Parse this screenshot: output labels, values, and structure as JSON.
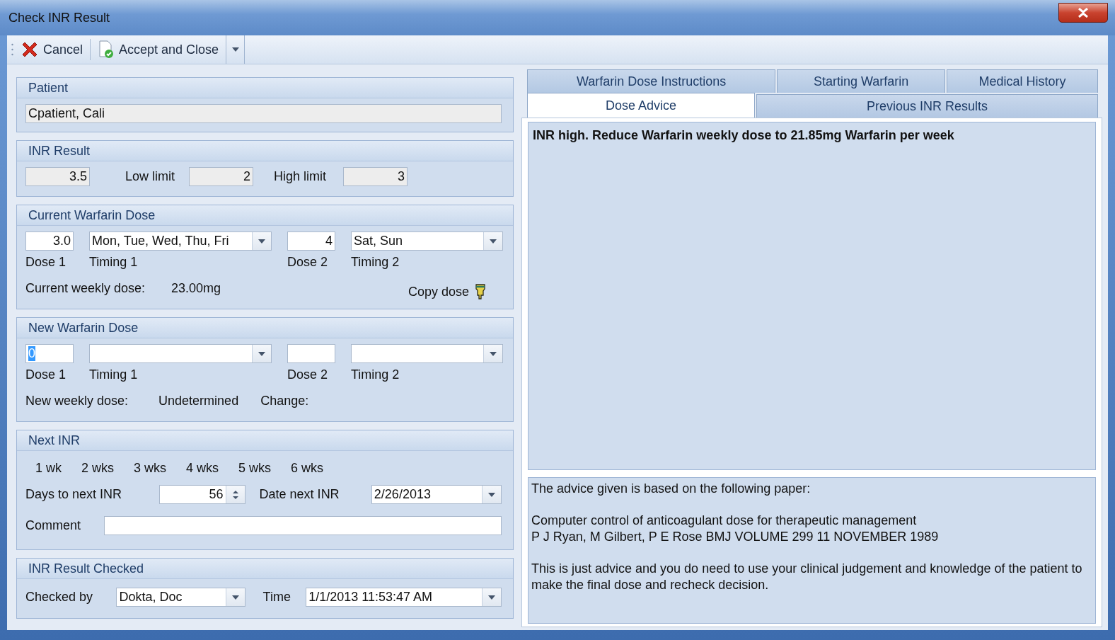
{
  "window": {
    "title": "Check INR Result"
  },
  "toolbar": {
    "buttons": [
      {
        "kind": "cancel",
        "label": "Cancel"
      },
      {
        "kind": "accept",
        "label": "Accept and Close"
      }
    ]
  },
  "patient": {
    "title": "Patient",
    "name": "Cpatient, Cali"
  },
  "inr_result": {
    "title": "INR Result",
    "value": "3.5",
    "low_label": "Low limit",
    "low": "2",
    "high_label": "High limit",
    "high": "3"
  },
  "current_dose": {
    "title": "Current Warfarin Dose",
    "dose1": "3.0",
    "timing1": "Mon, Tue, Wed, Thu, Fri",
    "dose2": "4",
    "timing2": "Sat, Sun",
    "labels": [
      "Dose 1",
      "Timing 1",
      "Dose 2",
      "Timing 2"
    ],
    "weekly_label": "Current weekly dose:",
    "weekly": "23.00mg",
    "copy": "Copy dose"
  },
  "new_dose": {
    "title": "New Warfarin Dose",
    "dose1": "0",
    "dose1_selected": true,
    "labels": [
      "Dose 1",
      "Timing 1",
      "Dose 2",
      "Timing 2"
    ],
    "weekly_label": "New weekly dose:",
    "weekly": "Undetermined",
    "change_label": "Change:"
  },
  "next_inr": {
    "title": "Next INR",
    "weeks": [
      "1 wk",
      "2 wks",
      "3 wks",
      "4 wks",
      "5 wks",
      "6 wks"
    ],
    "days_label": "Days to next INR",
    "days": "56",
    "date_label": "Date next INR",
    "date": "2/26/2013",
    "comment_label": "Comment"
  },
  "checked": {
    "title": "INR Result Checked",
    "by_label": "Checked by",
    "by": "Dokta, Doc",
    "time_label": "Time",
    "time": "1/1/2013 11:53:47 AM"
  },
  "tabs": {
    "rows": [
      [
        {
          "label": "Warfarin Dose Instructions",
          "selected": false
        },
        {
          "label": "Starting Warfarin",
          "selected": false
        },
        {
          "label": "Medical History",
          "selected": false
        }
      ],
      [
        {
          "label": "Dose Advice",
          "selected": true
        },
        {
          "label": "Previous INR Results",
          "selected": false
        }
      ]
    ]
  },
  "advice": {
    "text": "INR high. Reduce Warfarin weekly dose to 21.85mg Warfarin per week"
  },
  "paper": {
    "paragraphs": [
      [
        "The advice given is based on the following paper:"
      ],
      [
        "Computer control of anticoagulant dose for therapeutic management",
        "P J Ryan, M Gilbert, P E Rose BMJ VOLUME 299 11 NOVEMBER 1989"
      ],
      [
        "This is just advice and you do need to use your clinical judgement and knowledge of the patient to make the final dose and recheck decision."
      ]
    ]
  }
}
